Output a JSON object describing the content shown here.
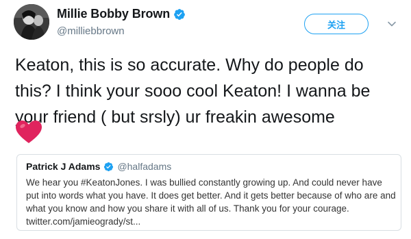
{
  "tweet": {
    "author": {
      "name": "Millie Bobby Brown",
      "handle": "@milliebbrown",
      "verified": true
    },
    "follow_label": "关注",
    "text": "Keaton, this is so accurate. Why do people do this? I think your sooo cool Keaton! I wanna be your friend ( but srsly) ur freakin awesome",
    "emoji": "red-heart-icon",
    "quoted": {
      "name": "Patrick J Adams",
      "handle": "@halfadams",
      "verified": true,
      "text": "We hear you #KeatonJones. I was bullied constantly growing up. And could never have put into words what you have. It does get better. And it gets better because of who are and what you know and how you share it with all of us. Thank you for your courage. twitter.com/jamieogrady/st..."
    }
  },
  "colors": {
    "accent": "#1da1f2",
    "text": "#14171a",
    "muted": "#657786",
    "heart": "#e0245e",
    "border": "#d8dee3"
  }
}
